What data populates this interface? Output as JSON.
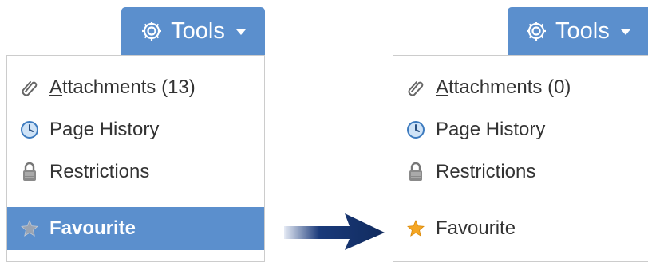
{
  "before": {
    "tools_label": "Tools",
    "menu": {
      "attachments_accel": "A",
      "attachments_rest": "ttachments (13)",
      "history_label": "Page History",
      "restrictions_label": "Restrictions",
      "favourite_label": "Favourite",
      "favourite_selected": true
    }
  },
  "after": {
    "tools_label": "Tools",
    "menu": {
      "attachments_accel": "A",
      "attachments_rest": "ttachments (0)",
      "history_label": "Page History",
      "restrictions_label": "Restrictions",
      "favourite_label": "Favourite",
      "favourite_selected": false
    }
  },
  "colors": {
    "accent": "#5b8fcd",
    "star_off": "#9aa4b2",
    "star_on": "#f5a623",
    "arrow": "#1a3a7a"
  },
  "icons": [
    "gear-icon",
    "chevron-down-icon",
    "paperclip-icon",
    "clock-icon",
    "lock-icon",
    "star-icon",
    "arrow-right-icon"
  ]
}
